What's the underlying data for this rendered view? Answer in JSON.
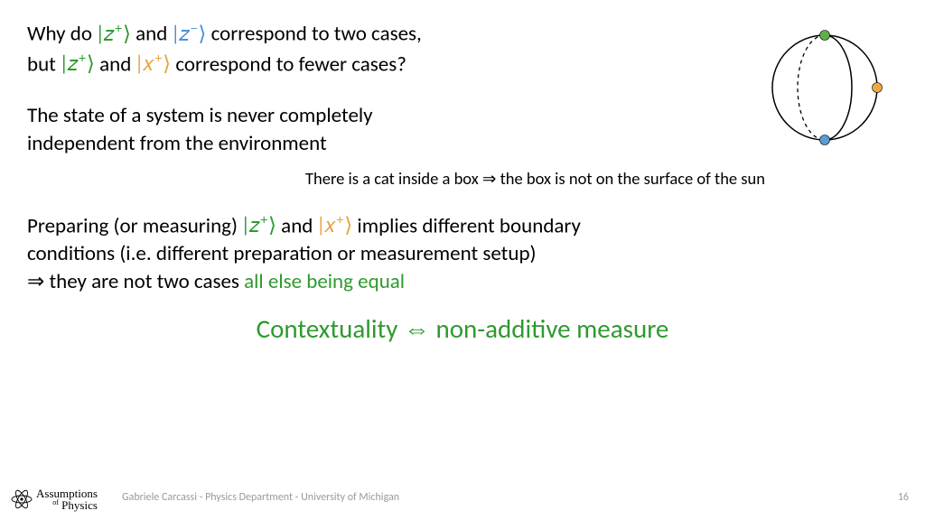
{
  "para1": {
    "pre1": "Why do ",
    "ket_z_plus_g": "|𝑧",
    "sup_plus": "+",
    "ket_close": "⟩",
    "and": " and ",
    "ket_z_minus_b": "|𝑧",
    "sup_minus": "−",
    "post1": " correspond to two cases,",
    "pre2": "but ",
    "ket_x_plus_o": "|𝑥",
    "post2": " correspond to fewer cases?"
  },
  "para2": {
    "l1": "The state of a system is never completely",
    "l2": "independent from the environment"
  },
  "catline": "There is a cat inside a box ⇒ the box is not on the surface of the sun",
  "para3": {
    "pre": "Preparing (or measuring) ",
    "mid": " implies different boundary",
    "l2": "conditions (i.e. different preparation or measurement setup)",
    "l3a": "⇒ they are not two cases ",
    "l3b": "all else being equal"
  },
  "conclusion": "Contextuality ⇔ non-additive measure",
  "footer": {
    "logo1": "Assumptions",
    "logo_of": "of",
    "logo2": "Physics",
    "author": "Gabriele Carcassi - Physics Department - University of Michigan",
    "page": "16"
  }
}
